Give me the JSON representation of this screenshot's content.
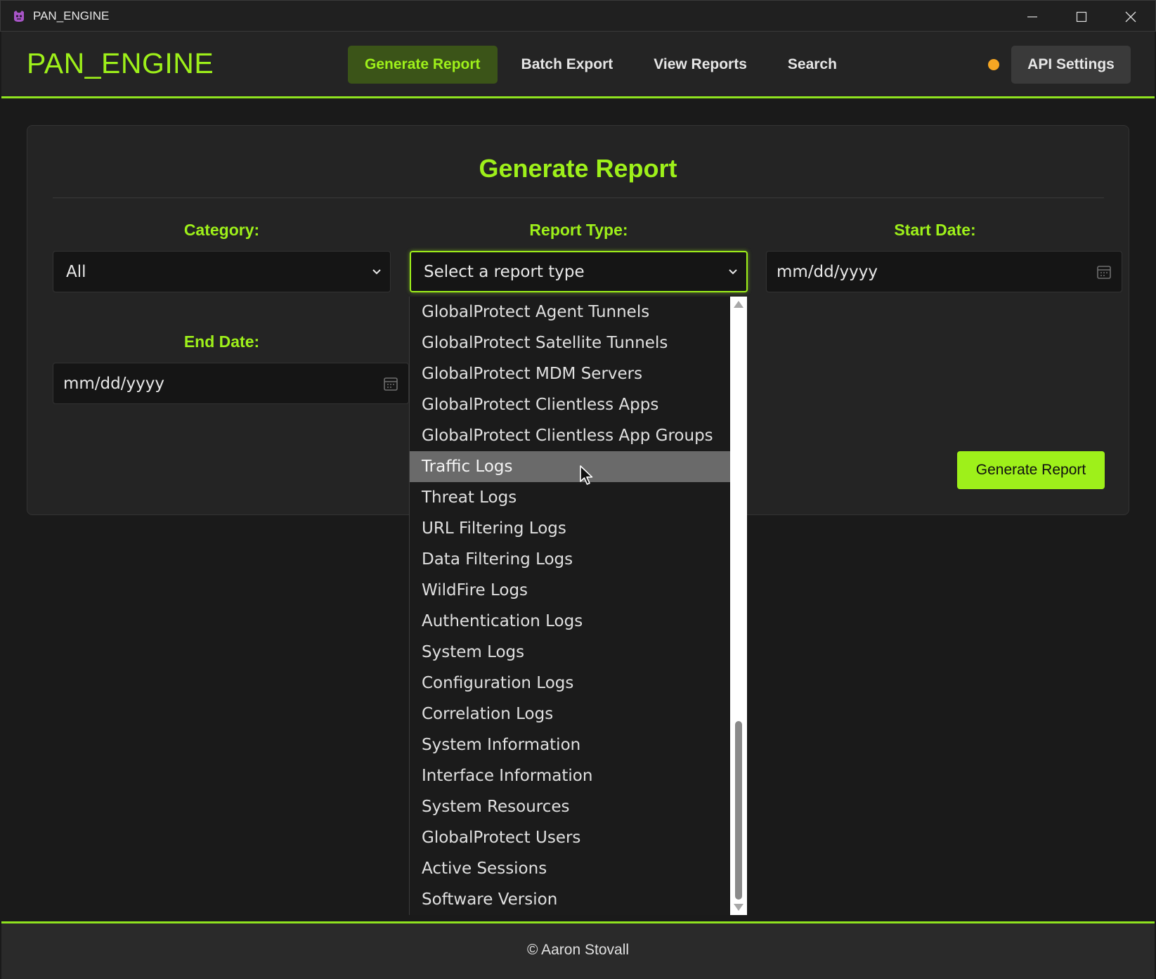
{
  "window": {
    "title": "PAN_ENGINE",
    "icon": "app-icon",
    "controls": [
      "minimize-icon",
      "maximize-icon",
      "close-icon"
    ]
  },
  "header": {
    "logo": "PAN_ENGINE",
    "nav": [
      {
        "label": "Generate Report",
        "active": true
      },
      {
        "label": "Batch Export",
        "active": false
      },
      {
        "label": "View Reports",
        "active": false
      },
      {
        "label": "Search",
        "active": false
      }
    ],
    "status_color": "#f5a623",
    "api_settings_label": "API Settings"
  },
  "form": {
    "title": "Generate Report",
    "category": {
      "label": "Category:",
      "value": "All"
    },
    "report_type": {
      "label": "Report Type:",
      "placeholder": "Select a report type"
    },
    "start_date": {
      "label": "Start Date:",
      "placeholder": "mm/dd/yyyy"
    },
    "end_date": {
      "label": "End Date:",
      "placeholder": "mm/dd/yyyy"
    },
    "submit_label": "Generate Report"
  },
  "dropdown": {
    "hovered": "Traffic Logs",
    "options": [
      "GlobalProtect Agent Tunnels",
      "GlobalProtect Satellite Tunnels",
      "GlobalProtect MDM Servers",
      "GlobalProtect Clientless Apps",
      "GlobalProtect Clientless App Groups",
      "Traffic Logs",
      "Threat Logs",
      "URL Filtering Logs",
      "Data Filtering Logs",
      "WildFire Logs",
      "Authentication Logs",
      "System Logs",
      "Configuration Logs",
      "Correlation Logs",
      "System Information",
      "Interface Information",
      "System Resources",
      "GlobalProtect Users",
      "Active Sessions",
      "Software Version"
    ]
  },
  "footer": {
    "text": "© Aaron Stovall"
  },
  "colors": {
    "accent": "#9ef01a",
    "background": "#1a1a1a",
    "panel": "#242424",
    "active_nav_bg": "#3b5418"
  }
}
